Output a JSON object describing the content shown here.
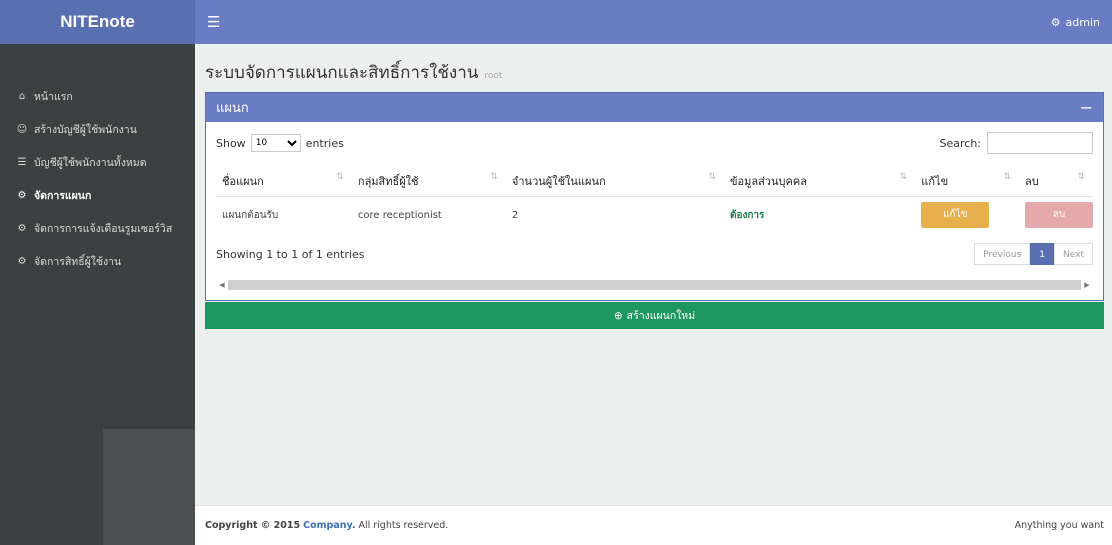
{
  "header": {
    "logo": "NITEnote",
    "menu_icon": "hamburger-icon",
    "user": "admin",
    "user_icon": "gear-icon"
  },
  "sidebar": {
    "items": [
      {
        "label": "หน้าแรก",
        "icon": "home-icon",
        "glyph": "⌂"
      },
      {
        "label": "สร้างบัญชีผู้ใช้พนักงาน",
        "icon": "user-add-icon",
        "glyph": "☺"
      },
      {
        "label": "บัญชีผู้ใช้พนักงานทั้งหมด",
        "icon": "users-icon",
        "glyph": "☰"
      },
      {
        "label": "จัดการแผนก",
        "icon": "cogs-icon",
        "glyph": "⚙"
      },
      {
        "label": "จัดการการแจ้งเตือนรูมเซอร์วิส",
        "icon": "cogs-icon",
        "glyph": "⚙"
      },
      {
        "label": "จัดการสิทธิ์ผู้ใช้งาน",
        "icon": "cogs-icon",
        "glyph": "⚙"
      }
    ]
  },
  "page": {
    "title": "ระบบจัดการแผนกและสิทธิ์การใช้งาน",
    "subtitle": "root"
  },
  "box": {
    "title": "แผนก",
    "collapse": "−",
    "show_label": "Show",
    "entries_label": "entries",
    "length_value": "10",
    "search_label": "Search:",
    "columns": [
      "ชื่อแผนก",
      "กลุ่มสิทธิ์ผู้ใช้",
      "จำนวนผู้ใช้ในแผนก",
      "ข้อมูลส่วนบุคคล",
      "แก้ไข",
      "ลบ"
    ],
    "rows": [
      {
        "name": "แผนกต้อนรับ",
        "group": "core receptionist",
        "count": "2",
        "personal": "ต้องการ",
        "edit": "แก้ไข",
        "delete": "ลบ"
      }
    ],
    "info": "Showing 1 to 1 of 1 entries",
    "prev": "Previous",
    "page": "1",
    "next": "Next"
  },
  "create_button": "สร้างแผนกใหม่",
  "footer": {
    "copyright": "Copyright © 2015",
    "company": "Company.",
    "rights": "All rights reserved.",
    "right_text": "Anything you want"
  },
  "colors": {
    "header": "#6a7dc4",
    "sidebar": "#3a4140",
    "create": "#1e9660",
    "edit": "#e8b04d",
    "delete": "#e6a9ab"
  }
}
